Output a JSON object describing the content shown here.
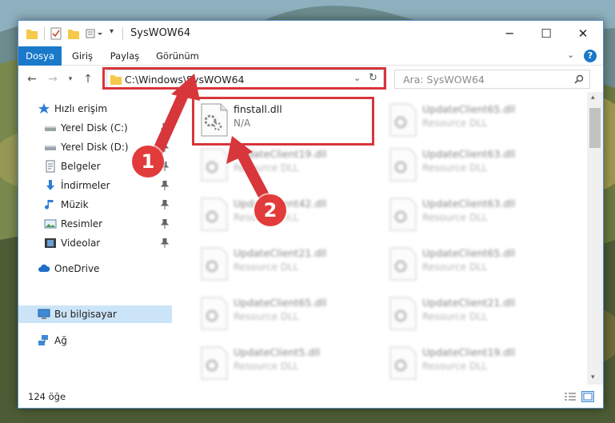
{
  "window": {
    "title": "SysWOW64",
    "controls": {
      "minimize": "─",
      "maximize": "☐",
      "close": "✕"
    }
  },
  "ribbon": {
    "tabs": [
      "Dosya",
      "Giriş",
      "Paylaş",
      "Görünüm"
    ],
    "active_tab": "Dosya"
  },
  "address": {
    "path": "C:\\Windows\\SysWOW64",
    "search_placeholder": "Ara: SysWOW64"
  },
  "sidebar": {
    "items": [
      {
        "label": "Hızlı erişim",
        "icon": "star-icon",
        "pinned": false
      },
      {
        "label": "Yerel Disk (C:)",
        "icon": "drive-icon",
        "pinned": true
      },
      {
        "label": "Yerel Disk (D:)",
        "icon": "drive-icon",
        "pinned": true
      },
      {
        "label": "Belgeler",
        "icon": "document-icon",
        "pinned": true
      },
      {
        "label": "İndirmeler",
        "icon": "download-icon",
        "pinned": true
      },
      {
        "label": "Müzik",
        "icon": "music-icon",
        "pinned": true
      },
      {
        "label": "Resimler",
        "icon": "pictures-icon",
        "pinned": true
      },
      {
        "label": "Videolar",
        "icon": "video-icon",
        "pinned": true
      },
      {
        "label": "OneDrive",
        "icon": "cloud-icon",
        "pinned": false
      },
      {
        "label": "Bu bilgisayar",
        "icon": "computer-icon",
        "pinned": false
      },
      {
        "label": "Ağ",
        "icon": "network-icon",
        "pinned": false
      }
    ]
  },
  "files": {
    "highlighted": {
      "name": "finstall.dll",
      "type": "N/A"
    },
    "left_column": [
      {
        "name": "UpdateClient19.dll",
        "type": "Resource DLL"
      },
      {
        "name": "UpdateClient42.dll",
        "type": "Resource DLL"
      },
      {
        "name": "UpdateClient21.dll",
        "type": "Resource DLL"
      },
      {
        "name": "UpdateClient65.dll",
        "type": "Resource DLL"
      },
      {
        "name": "UpdateClient5.dll",
        "type": "Resource DLL"
      }
    ],
    "right_column": [
      {
        "name": "UpdateClient65.dll",
        "type": "Resource DLL"
      },
      {
        "name": "UpdateClient63.dll",
        "type": "Resource DLL"
      },
      {
        "name": "UpdateClient63.dll",
        "type": "Resource DLL"
      },
      {
        "name": "UpdateClient65.dll",
        "type": "Resource DLL"
      },
      {
        "name": "UpdateClient21.dll",
        "type": "Resource DLL"
      },
      {
        "name": "UpdateClient19.dll",
        "type": "Resource DLL"
      }
    ]
  },
  "status": {
    "item_count": "124 öğe"
  },
  "annotations": {
    "marker1": "1",
    "marker2": "2",
    "color": "#e23b3b"
  }
}
